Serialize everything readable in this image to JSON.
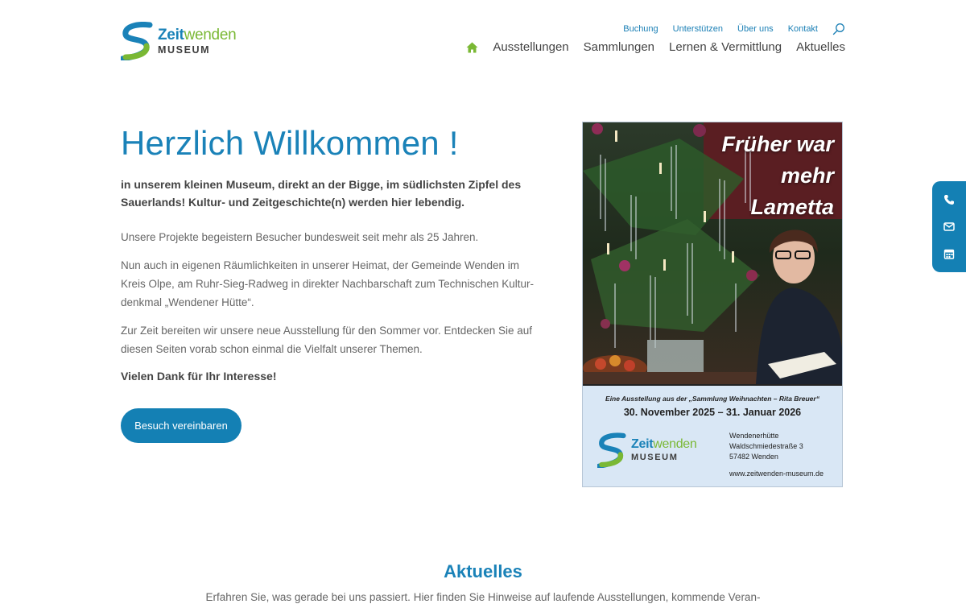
{
  "logo": {
    "word_part1": "Zeit",
    "word_part2": "wenden",
    "sub": "MUSEUM"
  },
  "topbar": {
    "links": [
      "Buchung",
      "Unterstützen",
      "Über uns",
      "Kontakt"
    ]
  },
  "mainnav": {
    "items": [
      "Ausstellungen",
      "Sammlungen",
      "Lernen & Vermittlung",
      "Aktuelles"
    ]
  },
  "hero": {
    "title": "Herzlich Willkommen !",
    "lead": "in unserem kleinen Museum, direkt an der Bigge, im südlichsten Zipfel des Sauer­lands! Kultur- und Zeitgeschichte(n) werden hier lebendig.",
    "p1": "Unsere Projekte begeistern Besucher bundesweit seit mehr als 25 Jahren.",
    "p2": "Nun auch in eigenen Räumlichkeiten in unserer Heimat, der Gemeinde Wenden im Kreis Olpe, am Ruhr-Sieg-Radweg in direkter Nachbarschaft zum Technischen Kultur­denkmal „Wendener Hütte“.",
    "p3": "Zur Zeit bereiten wir unsere neue Ausstellung für den Sommer vor. Entdecken Sie auf diesen Seiten vorab schon einmal die Vielfalt unserer Themen.",
    "thanks": "Vielen Dank für Ihr Interesse!",
    "cta": "Besuch vereinbaren"
  },
  "poster": {
    "heading_line1": "Früher war",
    "heading_line2": "mehr",
    "heading_line3": "Lametta",
    "subtitle": "Eine Ausstellung aus der „Sammlung Weihnachten – Rita Breuer“",
    "dates": "30. November 2025 – 31. Januar 2026",
    "address_line1": "Wendenerhütte",
    "address_line2": "Waldschmiedestraße 3",
    "address_line3": "57482 Wenden",
    "url": "www.zeitwenden-museum.de"
  },
  "section": {
    "title": "Aktuelles",
    "text": "Erfahren Sie, was gerade bei uns passiert. Hier finden Sie Hinweise auf laufende Ausstellungen, kommende Veran-"
  },
  "colors": {
    "brand_blue": "#1a82b8",
    "brand_green": "#7ab834",
    "button_blue": "#1480b4"
  },
  "icons": [
    "search-icon",
    "home-icon",
    "phone-icon",
    "mail-icon",
    "calendar-icon"
  ]
}
